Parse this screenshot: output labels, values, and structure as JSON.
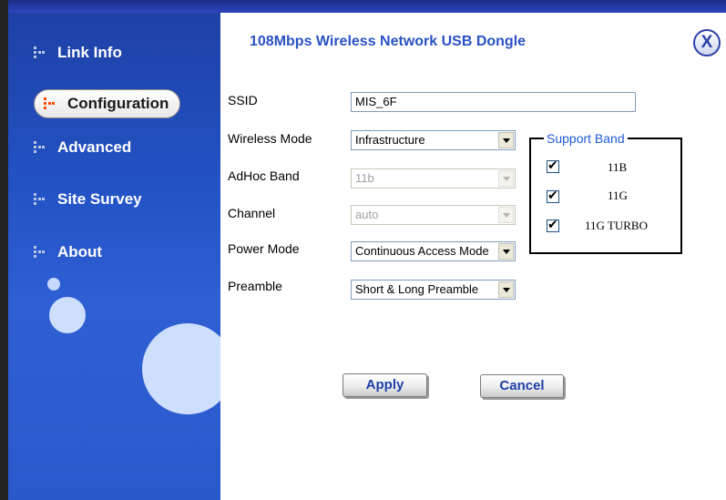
{
  "window": {
    "title": "108Mbps Wireless Network USB Dongle",
    "close_label": "X"
  },
  "sidebar": {
    "items": [
      {
        "label": "Link Info",
        "active": false
      },
      {
        "label": "Configuration",
        "active": true
      },
      {
        "label": "Advanced",
        "active": false
      },
      {
        "label": "Site Survey",
        "active": false
      },
      {
        "label": "About",
        "active": false
      }
    ]
  },
  "form": {
    "ssid": {
      "label": "SSID",
      "value": "MIS_6F"
    },
    "wireless_mode": {
      "label": "Wireless Mode",
      "value": "Infrastructure"
    },
    "adhoc_band": {
      "label": "AdHoc Band",
      "value": "11b",
      "disabled": true
    },
    "channel": {
      "label": "Channel",
      "value": "auto",
      "disabled": true
    },
    "power_mode": {
      "label": "Power Mode",
      "value": "Continuous Access Mode"
    },
    "preamble": {
      "label": "Preamble",
      "value": "Short & Long Preamble"
    }
  },
  "support_band": {
    "legend": "Support Band",
    "options": [
      {
        "label": "11B",
        "checked": true
      },
      {
        "label": "11G",
        "checked": true
      },
      {
        "label": "11G TURBO",
        "checked": true
      }
    ]
  },
  "buttons": {
    "apply": "Apply",
    "cancel": "Cancel"
  },
  "colors": {
    "sidebar_blue": "#2352c4",
    "title_blue": "#2a52c4",
    "legend_blue": "#1f5bd8",
    "active_icon": "#ff4a00"
  }
}
